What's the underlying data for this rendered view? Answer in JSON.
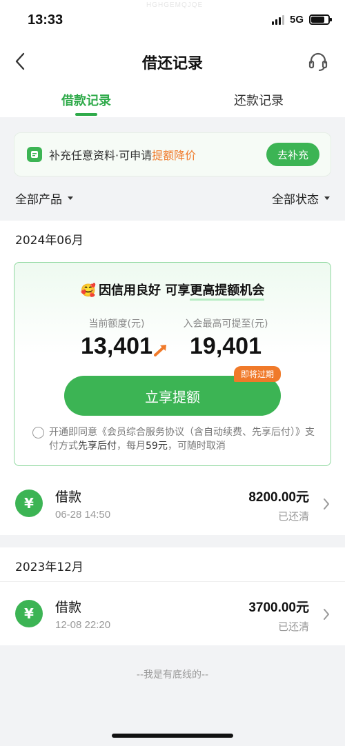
{
  "status_bar": {
    "time": "13:33",
    "network": "5G",
    "watermark": "HGHGEMQJQE"
  },
  "nav": {
    "title": "借还记录"
  },
  "tabs": [
    {
      "label": "借款记录",
      "active": true
    },
    {
      "label": "还款记录",
      "active": false
    }
  ],
  "banner": {
    "text_prefix": "补充任意资料·可申请",
    "text_highlight": "提额降价",
    "button": "去补充"
  },
  "filters": {
    "product": "全部产品",
    "status": "全部状态"
  },
  "sections": [
    {
      "month": "2024年06月",
      "promo": {
        "emoji": "🥰",
        "title_prefix": "因信用良好 可享",
        "title_highlight": "更高提额机会",
        "current_label": "当前额度(元)",
        "current_value": "13,401",
        "member_label": "入会最高可提至(元)",
        "member_value": "19,401",
        "cta": "立享提额",
        "badge": "即将过期",
        "agree_a": "开通即同意《会员综合服务协议（含自动续费、先享后付）》支付方式",
        "agree_b": "先享后付",
        "agree_c": "，每月",
        "agree_d": "59元",
        "agree_e": "，可随时取消"
      },
      "record": {
        "title": "借款",
        "time": "06-28 14:50",
        "amount": "8200.00元",
        "status": "已还清"
      }
    },
    {
      "month": "2023年12月",
      "record": {
        "title": "借款",
        "time": "12-08 22:20",
        "amount": "3700.00元",
        "status": "已还清"
      }
    }
  ],
  "footer": "--我是有底线的--",
  "colors": {
    "brand_green": "#3cb454",
    "accent_orange": "#f07a2a"
  },
  "icons": [
    "back-arrow-icon",
    "headset-icon",
    "document-icon",
    "caret-down-icon",
    "yuan-icon",
    "chevron-right-icon",
    "arrow-up-right-icon"
  ]
}
